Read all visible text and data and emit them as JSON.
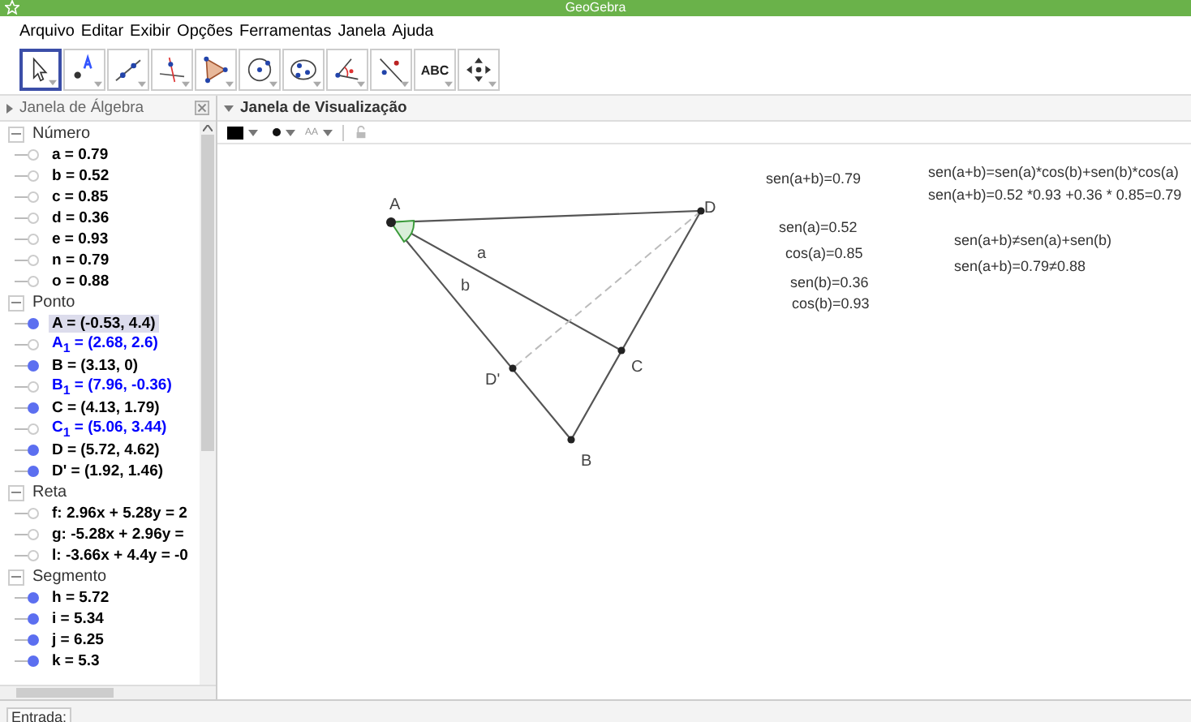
{
  "window": {
    "title": "GeoGebra"
  },
  "menu": [
    "Arquivo",
    "Editar",
    "Exibir",
    "Opções",
    "Ferramentas",
    "Janela",
    "Ajuda"
  ],
  "tools": [
    {
      "kind": "move",
      "selected": true
    },
    {
      "kind": "point",
      "selected": false
    },
    {
      "kind": "line",
      "selected": false
    },
    {
      "kind": "perpendicular",
      "selected": false
    },
    {
      "kind": "polygon",
      "selected": false
    },
    {
      "kind": "circle",
      "selected": false
    },
    {
      "kind": "conic",
      "selected": false
    },
    {
      "kind": "angle",
      "selected": false
    },
    {
      "kind": "reflect",
      "selected": false
    },
    {
      "kind": "text",
      "label": "ABC",
      "selected": false
    },
    {
      "kind": "pan",
      "selected": false
    }
  ],
  "algebra": {
    "title": "Janela de Álgebra",
    "groups": [
      {
        "name": "Número",
        "expanded": true,
        "items": [
          {
            "text": "a = 0.79",
            "visible": false,
            "color": "#000000",
            "selected": false
          },
          {
            "text": "b = 0.52",
            "visible": false,
            "color": "#000000",
            "selected": false
          },
          {
            "text": "c = 0.85",
            "visible": false,
            "color": "#000000",
            "selected": false
          },
          {
            "text": "d = 0.36",
            "visible": false,
            "color": "#000000",
            "selected": false
          },
          {
            "text": "e = 0.93",
            "visible": false,
            "color": "#000000",
            "selected": false
          },
          {
            "text": "n = 0.79",
            "visible": false,
            "color": "#000000",
            "selected": false
          },
          {
            "text": "o = 0.88",
            "visible": false,
            "color": "#000000",
            "selected": false
          }
        ]
      },
      {
        "name": "Ponto",
        "expanded": true,
        "items": [
          {
            "text": "A = (-0.53, 4.4)",
            "visible": true,
            "color": "#000000",
            "selected": true
          },
          {
            "text": "A$_{1}$ = (2.68, 2.6)",
            "visible": false,
            "color": "#0000ff",
            "selected": false
          },
          {
            "text": "B = (3.13, 0)",
            "visible": true,
            "color": "#000000",
            "selected": false
          },
          {
            "text": "B$_{1}$ = (7.96, -0.36)",
            "visible": false,
            "color": "#0000ff",
            "selected": false
          },
          {
            "text": "C = (4.13, 1.79)",
            "visible": true,
            "color": "#000000",
            "selected": false
          },
          {
            "text": "C$_{1}$ = (5.06, 3.44)",
            "visible": false,
            "color": "#0000ff",
            "selected": false
          },
          {
            "text": "D = (5.72, 4.62)",
            "visible": true,
            "color": "#000000",
            "selected": false
          },
          {
            "text": "D' = (1.92, 1.46)",
            "visible": true,
            "color": "#000000",
            "selected": false
          }
        ]
      },
      {
        "name": "Reta",
        "expanded": true,
        "items": [
          {
            "text": "f: 2.96x + 5.28y = 2",
            "visible": false,
            "color": "#000000",
            "selected": false
          },
          {
            "text": "g: -5.28x + 2.96y =",
            "visible": false,
            "color": "#000000",
            "selected": false
          },
          {
            "text": "l: -3.66x + 4.4y = -0",
            "visible": false,
            "color": "#000000",
            "selected": false
          }
        ]
      },
      {
        "name": "Segmento",
        "expanded": true,
        "items": [
          {
            "text": "h = 5.72",
            "visible": true,
            "color": "#000000",
            "selected": false
          },
          {
            "text": "i = 5.34",
            "visible": true,
            "color": "#000000",
            "selected": false
          },
          {
            "text": "j = 6.25",
            "visible": true,
            "color": "#000000",
            "selected": false
          },
          {
            "text": "k = 5.3",
            "visible": true,
            "color": "#000000",
            "selected": false
          }
        ]
      }
    ]
  },
  "graphics": {
    "title": "Janela de Visualização",
    "text_size_label": "AA",
    "points": [
      "A",
      "D",
      "C",
      "D'",
      "B"
    ],
    "segment_labels": [
      "a",
      "b"
    ],
    "texts": [
      "sen(a+b)=0.79",
      "sen(a)=0.52",
      "cos(a)=0.85",
      "sen(b)=0.36",
      "cos(b)=0.93",
      "sen(a+b)=sen(a)*cos(b)+sen(b)*cos(a)",
      "sen(a+b)=0.52 *0.93 +0.36 * 0.85=0.79",
      "sen(a+b)≠sen(a)+sen(b)",
      "sen(a+b)=0.79≠0.88"
    ]
  },
  "input_bar": {
    "label": "Entrada:"
  }
}
